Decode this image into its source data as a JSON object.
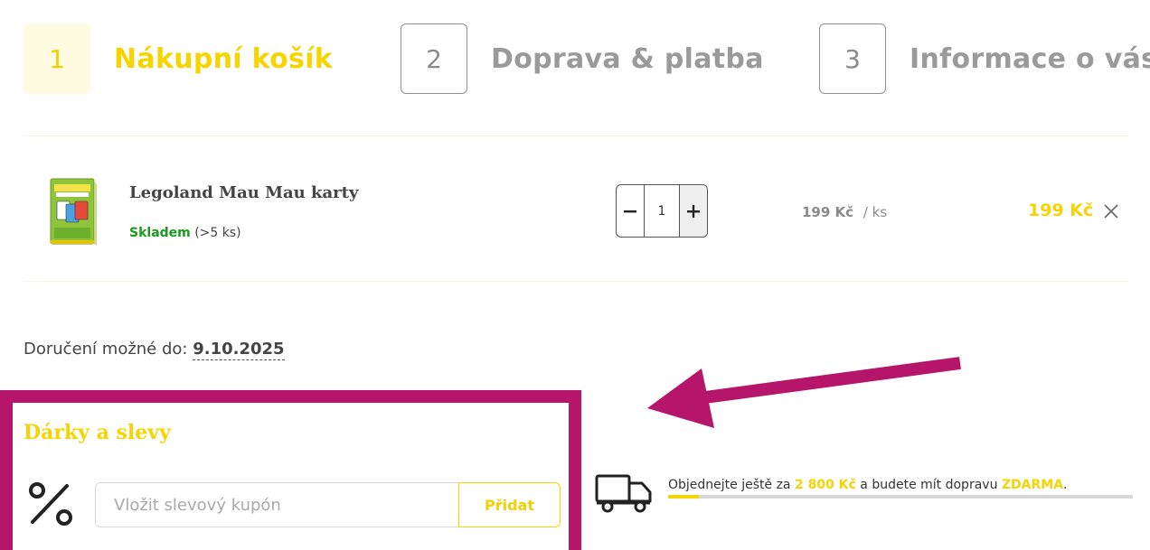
{
  "steps": [
    {
      "num": "1",
      "label": "Nákupní košík",
      "active": true
    },
    {
      "num": "2",
      "label": "Doprava & platba",
      "active": false
    },
    {
      "num": "3",
      "label": "Informace o vás",
      "active": false
    }
  ],
  "cart": {
    "item": {
      "name": "Legoland Mau Mau karty",
      "image_alt": "Mau Mau Legoland",
      "stock_status": "Skladem",
      "stock_detail": "(>5 ks)",
      "quantity": "1",
      "unit_price": "199 Kč",
      "unit_suffix": "/ ks",
      "total_price": "199 Kč"
    }
  },
  "delivery": {
    "label": "Doručení možné do:",
    "date": "9.10.2025"
  },
  "coupon": {
    "title": "Dárky a slevy",
    "placeholder": "Vložit slevový kupón",
    "button_label": "Přidat"
  },
  "free_shipping": {
    "prefix": "Objednejte ještě za",
    "amount": "2 800 Kč",
    "middle": "a budete mít dopravu",
    "highlight": "ZDARMA",
    "suffix": ".",
    "progress": 0.066
  },
  "colors": {
    "accent_yellow": "#f5d400",
    "highlight_magenta": "#b5166a",
    "stock_green": "#1a9a1a"
  },
  "icons": {
    "quantity_minus": "minus-icon",
    "quantity_plus": "plus-icon",
    "remove": "close-icon",
    "discount": "percent-icon",
    "shipping": "truck-icon"
  }
}
